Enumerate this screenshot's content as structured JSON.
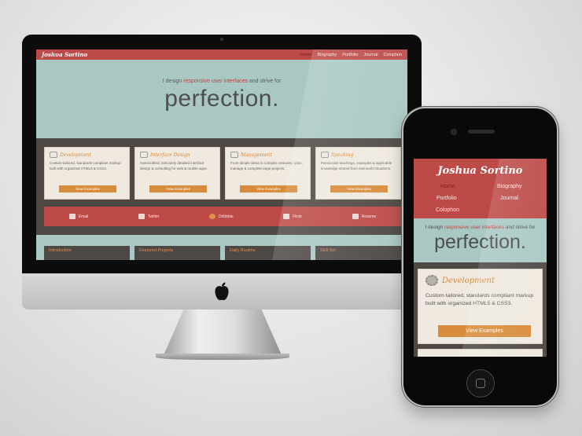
{
  "site": {
    "logo": "Joshua Sortino",
    "nav": [
      "Home",
      "Biography",
      "Portfolio",
      "Journal",
      "Colophon"
    ],
    "hero_intro": "I design",
    "hero_highlight": "responsive user interfaces",
    "hero_outro": "and strive for",
    "hero_big": "perfection.",
    "cards": [
      {
        "title": "Development",
        "icon": "gears-icon",
        "desc": "Custom-tailored, standards compliant markup built with organized HTML5 & CSS3.",
        "button": "View Examples"
      },
      {
        "title": "Interface Design",
        "icon": "grid-icon",
        "desc": "Handcrafted, intricately detailed interface design & consulting for web & mobile apps.",
        "button": "View Examples"
      },
      {
        "title": "Management",
        "icon": "clock-icon",
        "desc": "From simple ideas to complex ventures I plan, manage & complete large projects.",
        "button": "View Examples"
      },
      {
        "title": "Speaking",
        "icon": "speaker-icon",
        "desc": "Passionate teachings, examples & applicable knowledge shared from real-world situations.",
        "button": "View Examples"
      }
    ],
    "social": [
      {
        "label": "Email",
        "icon": "mail-icon"
      },
      {
        "label": "Twitter",
        "icon": "twitter-icon"
      },
      {
        "label": "Dribbble",
        "icon": "dribbble-icon"
      },
      {
        "label": "Flickr",
        "icon": "flickr-icon"
      },
      {
        "label": "Resume",
        "icon": "resume-icon"
      }
    ],
    "tabs": [
      "Introduction",
      "Featured Projects",
      "Daily Routine",
      "Skill Set"
    ]
  },
  "mobile": {
    "card_desc": "Custom-tailored, standards compliant markup built with organized HTML5 & CSS3."
  },
  "colors": {
    "brand_red": "#bd4a47",
    "teal_bg": "#a9c8c4",
    "dark_bg": "#4e4845",
    "accent_orange": "#d88b3a"
  }
}
